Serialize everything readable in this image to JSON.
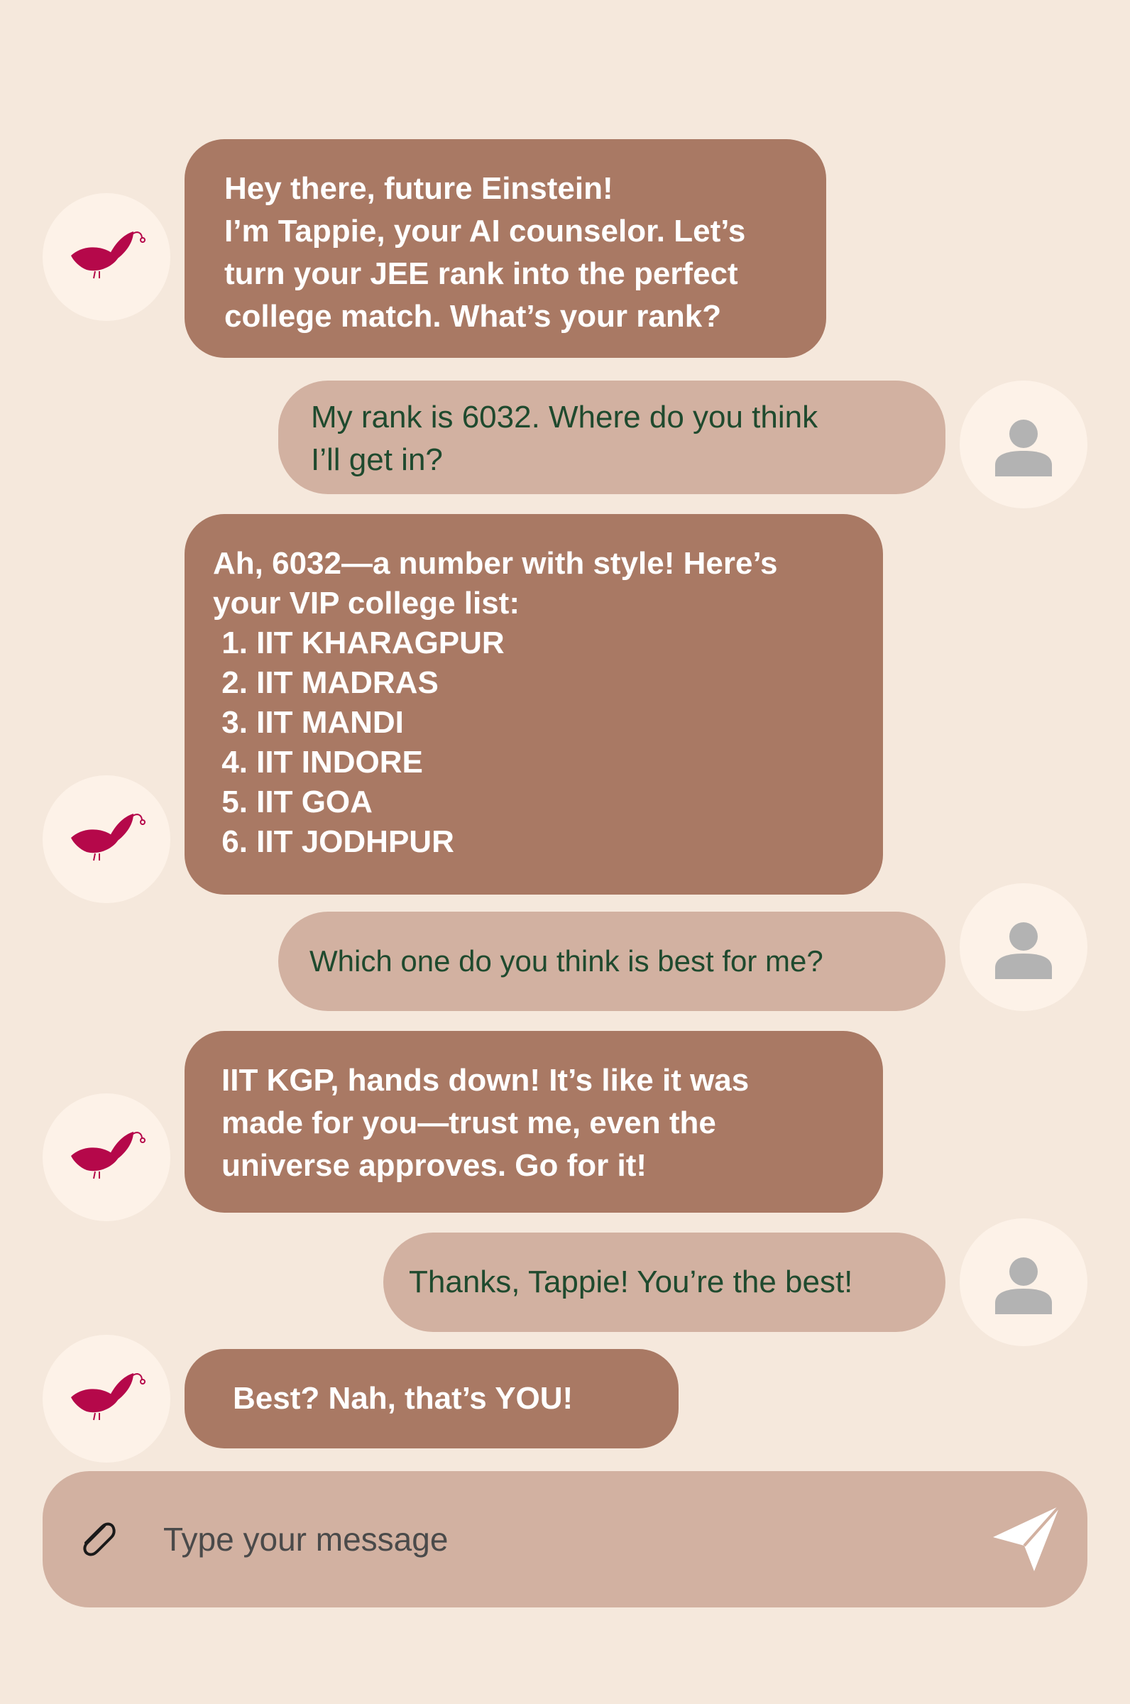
{
  "colors": {
    "background": "#f5e8dc",
    "bot_bubble": "#a97964",
    "user_bubble": "#d2b1a1",
    "avatar_bg": "#fdf2e8",
    "user_text": "#1f4a2e",
    "logo_accent": "#b5084a"
  },
  "bot": {
    "avatar_icon": "tappie-bird-logo-icon"
  },
  "user": {
    "avatar_icon": "person-silhouette-icon"
  },
  "messages": {
    "m1": {
      "sender": "bot",
      "lines": [
        "Hey there, future Einstein!",
        "I’m Tappie, your AI counselor. Let’s",
        "turn your JEE rank into the perfect",
        "college match. What’s your rank?"
      ]
    },
    "m2": {
      "sender": "user",
      "lines": [
        "My rank is 6032. Where do you think",
        "I’ll get in?"
      ]
    },
    "m3": {
      "sender": "bot",
      "lines": [
        "Ah, 6032—a number with style! Here’s",
        "your VIP college list:"
      ],
      "list": [
        " 1. IIT KHARAGPUR",
        " 2. IIT MADRAS",
        " 3. IIT MANDI",
        " 4. IIT INDORE",
        " 5. IIT GOA",
        " 6. IIT JODHPUR"
      ]
    },
    "m4": {
      "sender": "user",
      "text": "Which one do you think is best for me?"
    },
    "m5": {
      "sender": "bot",
      "lines": [
        "IIT KGP, hands down! It’s like it was",
        "made for you—trust me, even the",
        "universe approves. Go for it!"
      ]
    },
    "m6": {
      "sender": "user",
      "text": "Thanks, Tappie! You’re the best!"
    },
    "m7": {
      "sender": "bot",
      "text": "Best? Nah, that’s YOU!"
    }
  },
  "composer": {
    "placeholder": "Type your message",
    "value": "",
    "attach_icon": "paperclip-icon",
    "send_icon": "send-paper-plane-icon"
  }
}
